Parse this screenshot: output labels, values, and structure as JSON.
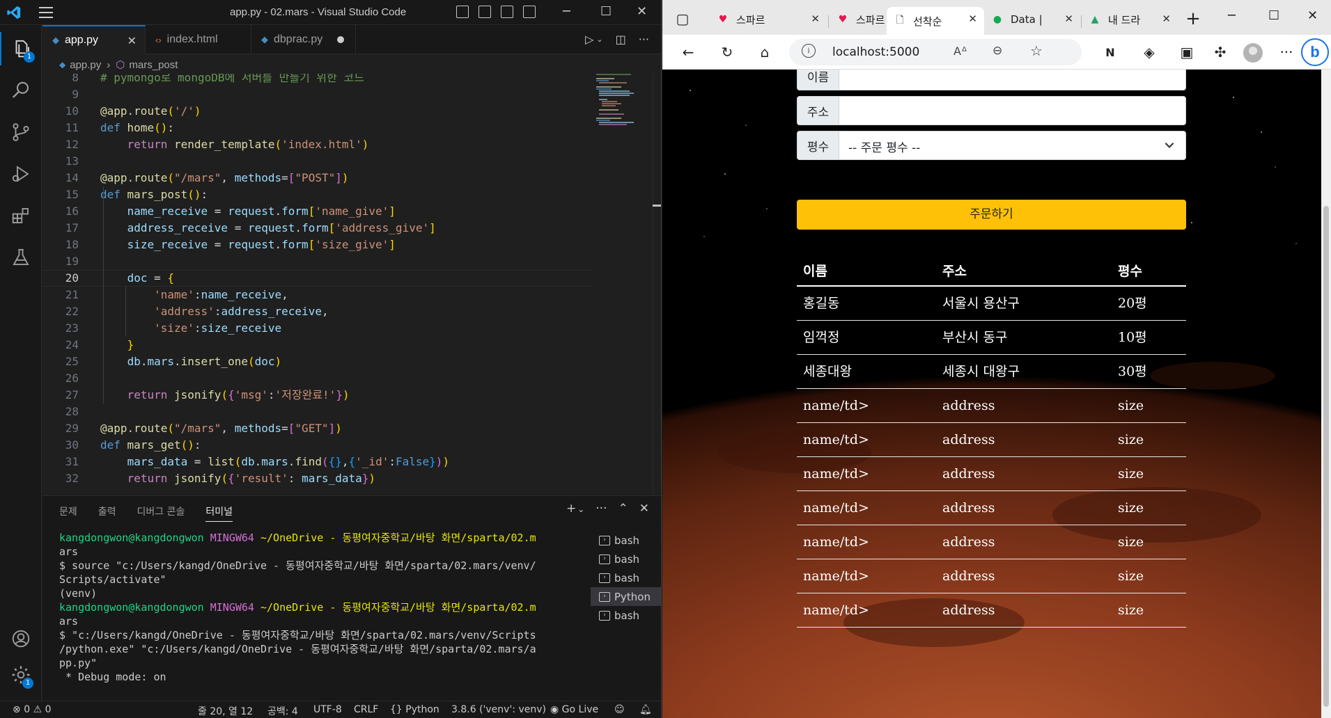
{
  "vscode": {
    "window_title": "app.py - 02.mars - Visual Studio Code",
    "tabs": [
      {
        "label": "app.py",
        "icon": "python-file-icon",
        "active": true
      },
      {
        "label": "index.html",
        "icon": "html-file-icon",
        "active": false
      },
      {
        "label": "dbprac.py",
        "icon": "python-file-icon",
        "active": false,
        "modified": true
      }
    ],
    "breadcrumb": {
      "file": "app.py",
      "symbol": "mars_post"
    },
    "explorer_badge": "1",
    "settings_badge": "1",
    "code_lines": [
      {
        "n": "8",
        "text": "# pymongo로 mongoDB에 서버를 만들기 위한 코드"
      },
      {
        "n": "9",
        "text": ""
      },
      {
        "n": "10",
        "text": "@app.route('/')"
      },
      {
        "n": "11",
        "text": "def home():"
      },
      {
        "n": "12",
        "text": "    return render_template('index.html')"
      },
      {
        "n": "13",
        "text": ""
      },
      {
        "n": "14",
        "text": "@app.route(\"/mars\", methods=[\"POST\"])"
      },
      {
        "n": "15",
        "text": "def mars_post():"
      },
      {
        "n": "16",
        "text": "    name_receive = request.form['name_give']"
      },
      {
        "n": "17",
        "text": "    address_receive = request.form['address_give']"
      },
      {
        "n": "18",
        "text": "    size_receive = request.form['size_give']"
      },
      {
        "n": "19",
        "text": ""
      },
      {
        "n": "20",
        "text": "    doc = {"
      },
      {
        "n": "21",
        "text": "        'name':name_receive,"
      },
      {
        "n": "22",
        "text": "        'address':address_receive,"
      },
      {
        "n": "23",
        "text": "        'size':size_receive"
      },
      {
        "n": "24",
        "text": "    }"
      },
      {
        "n": "25",
        "text": "    db.mars.insert_one(doc)"
      },
      {
        "n": "26",
        "text": ""
      },
      {
        "n": "27",
        "text": "    return jsonify({'msg':'저장완료!'})"
      },
      {
        "n": "28",
        "text": ""
      },
      {
        "n": "29",
        "text": "@app.route(\"/mars\", methods=[\"GET\"])"
      },
      {
        "n": "30",
        "text": "def mars_get():"
      },
      {
        "n": "31",
        "text": "    mars_data = list(db.mars.find({},{'_id':False}))"
      },
      {
        "n": "32",
        "text": "    return jsonify({'result': mars_data})"
      }
    ],
    "panel_tabs": [
      "문제",
      "출력",
      "디버그 콘솔",
      "터미널"
    ],
    "terminal_lines": [
      {
        "user": "kangdongwon@kangdongwon",
        "host": "MINGW64",
        "path": "~/OneDrive - 동평여자중학교/바탕 화면/sparta/02.m"
      },
      {
        "plain": "ars"
      },
      {
        "plain": "$ source \"c:/Users/kangd/OneDrive - 동평여자중학교/바탕 화면/sparta/02.mars/venv/"
      },
      {
        "plain": "Scripts/activate\""
      },
      {
        "plain": "(venv)"
      },
      {
        "user": "kangdongwon@kangdongwon",
        "host": "MINGW64",
        "path": "~/OneDrive - 동평여자중학교/바탕 화면/sparta/02.m"
      },
      {
        "plain": "ars"
      },
      {
        "plain": "$ \"c:/Users/kangd/OneDrive - 동평여자중학교/바탕 화면/sparta/02.mars/venv/Scripts"
      },
      {
        "plain": "/python.exe\" \"c:/Users/kangd/OneDrive - 동평여자중학교/바탕 화면/sparta/02.mars/a"
      },
      {
        "plain": "pp.py\""
      },
      {
        "plain": " * Debug mode: on"
      }
    ],
    "terminal_list": [
      "bash",
      "bash",
      "bash",
      "Python",
      "bash"
    ],
    "status": {
      "errors": "0",
      "warnings": "0",
      "position": "줄 20, 열 12",
      "spaces": "공백: 4",
      "encoding": "UTF-8",
      "eol": "CRLF",
      "language": "Python",
      "interpreter": "3.8.6 ('venv': venv)",
      "golive": "Go Live"
    }
  },
  "browser": {
    "tabs": [
      {
        "label": "스파르",
        "icon": "heart-icon"
      },
      {
        "label": "스파르",
        "icon": "heart-icon"
      },
      {
        "label": "선착순",
        "icon": "page-icon",
        "active": true
      },
      {
        "label": "Data |",
        "icon": "mongo-leaf-icon"
      },
      {
        "label": "내 드라",
        "icon": "drive-icon"
      }
    ],
    "url": "localhost:5000",
    "form": {
      "name_label": "이름",
      "address_label": "주소",
      "size_label": "평수",
      "size_placeholder": "-- 주문 평수 --",
      "order_button": "주문하기"
    },
    "table": {
      "headers": [
        "이름",
        "주소",
        "평수"
      ],
      "rows": [
        [
          "홍길동",
          "서울시 용산구",
          "20평"
        ],
        [
          "임꺽정",
          "부산시 동구",
          "10평"
        ],
        [
          "세종대왕",
          "세종시 대왕구",
          "30평"
        ],
        [
          "name/td>",
          "address",
          "size"
        ],
        [
          "name/td>",
          "address",
          "size"
        ],
        [
          "name/td>",
          "address",
          "size"
        ],
        [
          "name/td>",
          "address",
          "size"
        ],
        [
          "name/td>",
          "address",
          "size"
        ],
        [
          "name/td>",
          "address",
          "size"
        ],
        [
          "name/td>",
          "address",
          "size"
        ]
      ]
    }
  }
}
